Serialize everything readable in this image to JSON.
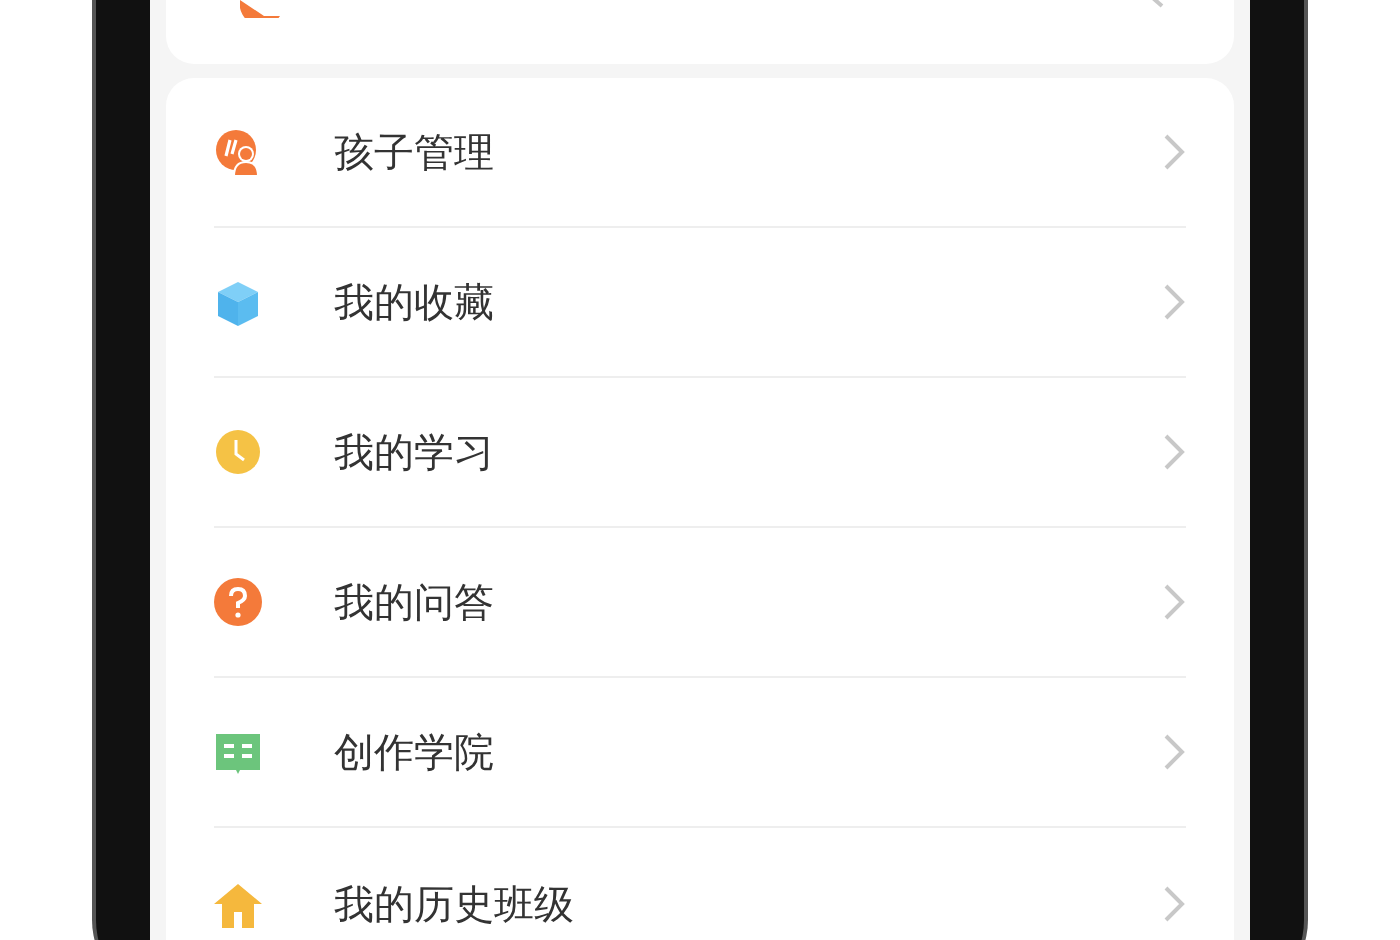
{
  "menu_items": [
    {
      "kind": "children",
      "label": "孩子管理"
    },
    {
      "kind": "favorites",
      "label": "我的收藏"
    },
    {
      "kind": "study",
      "label": "我的学习"
    },
    {
      "kind": "qa",
      "label": "我的问答"
    },
    {
      "kind": "academy",
      "label": "创作学院"
    },
    {
      "kind": "classes",
      "label": "我的历史班级"
    }
  ]
}
